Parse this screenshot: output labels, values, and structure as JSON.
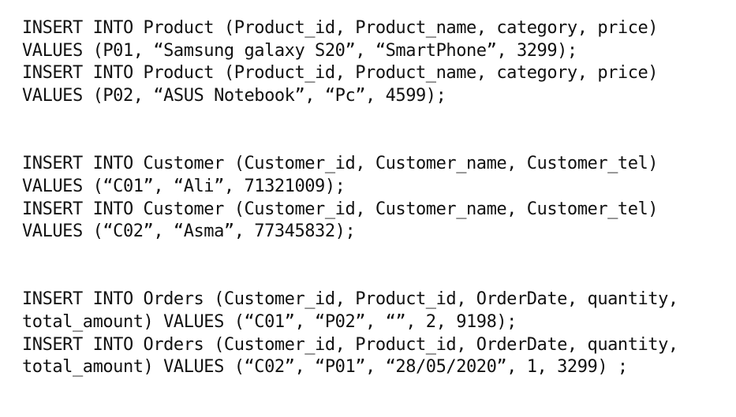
{
  "blocks": [
    {
      "name": "product-inserts",
      "lines": [
        "INSERT INTO Product (Product_id, Product_name, category, price)",
        "VALUES (P01, “Samsung galaxy S20”, “SmartPhone”, 3299);",
        "INSERT INTO Product (Product_id, Product_name, category, price)",
        "VALUES (P02, “ASUS Notebook”, “Pc”, 4599);"
      ]
    },
    {
      "name": "customer-inserts",
      "lines": [
        "INSERT INTO Customer (Customer_id, Customer_name, Customer_tel)",
        "VALUES (“C01”, “Ali”, 71321009);",
        "INSERT INTO Customer (Customer_id, Customer_name, Customer_tel)",
        "VALUES (“C02”, “Asma”, 77345832);"
      ]
    },
    {
      "name": "orders-inserts",
      "lines": [
        "INSERT INTO Orders (Customer_id, Product_id, OrderDate, quantity,",
        "total_amount) VALUES (“C01”, “P02”, “”, 2, 9198);",
        "INSERT INTO Orders (Customer_id, Product_id, OrderDate, quantity,",
        "total_amount) VALUES (“C02”, “P01”, “28/05/2020”, 1, 3299) ;"
      ]
    }
  ]
}
